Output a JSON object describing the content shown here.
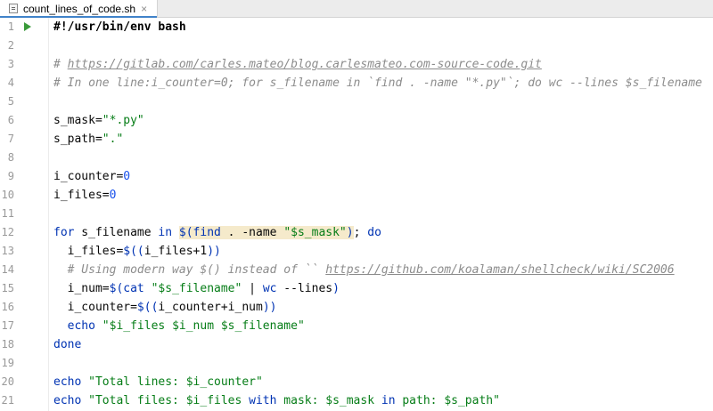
{
  "tab": {
    "label": "count_lines_of_code.sh",
    "close": "×"
  },
  "lines": [
    {
      "n": "1",
      "run": true,
      "parts": [
        {
          "t": "#!/usr/bin/env bash",
          "c": "shebang"
        }
      ]
    },
    {
      "n": "2",
      "parts": []
    },
    {
      "n": "3",
      "parts": [
        {
          "t": "# ",
          "c": "comment"
        },
        {
          "t": "https://gitlab.com/carles.mateo/blog.carlesmateo.com-source-code.git",
          "c": "link"
        }
      ]
    },
    {
      "n": "4",
      "parts": [
        {
          "t": "# In one line:i_counter=0; for s_filename in `find . -name \"*.py\"`; do wc --lines $s_filename",
          "c": "comment"
        }
      ]
    },
    {
      "n": "5",
      "parts": []
    },
    {
      "n": "6",
      "parts": [
        {
          "t": "s_mask=",
          "c": ""
        },
        {
          "t": "\"*.py\"",
          "c": "str"
        }
      ]
    },
    {
      "n": "7",
      "parts": [
        {
          "t": "s_path=",
          "c": ""
        },
        {
          "t": "\".\"",
          "c": "str"
        }
      ]
    },
    {
      "n": "8",
      "parts": []
    },
    {
      "n": "9",
      "parts": [
        {
          "t": "i_counter=",
          "c": ""
        },
        {
          "t": "0",
          "c": "num"
        }
      ]
    },
    {
      "n": "10",
      "parts": [
        {
          "t": "i_files=",
          "c": ""
        },
        {
          "t": "0",
          "c": "num"
        }
      ]
    },
    {
      "n": "11",
      "parts": []
    },
    {
      "n": "12",
      "parts": [
        {
          "t": "for",
          "c": "kw"
        },
        {
          "t": " s_filename ",
          "c": ""
        },
        {
          "t": "in",
          "c": "kw"
        },
        {
          "t": " ",
          "c": ""
        },
        {
          "t": "$(",
          "c": "kw hl"
        },
        {
          "t": "find",
          "c": "cmd hl"
        },
        {
          "t": " . -name ",
          "c": "hl"
        },
        {
          "t": "\"$s_mask\"",
          "c": "str hl"
        },
        {
          "t": ")",
          "c": "kw hl"
        },
        {
          "t": "; ",
          "c": ""
        },
        {
          "t": "do",
          "c": "kw"
        }
      ]
    },
    {
      "n": "13",
      "parts": [
        {
          "t": "  i_files=",
          "c": ""
        },
        {
          "t": "$((",
          "c": "kw"
        },
        {
          "t": "i_files+1",
          "c": ""
        },
        {
          "t": "))",
          "c": "kw"
        }
      ]
    },
    {
      "n": "14",
      "parts": [
        {
          "t": "  # Using modern way $() instead of `` ",
          "c": "comment"
        },
        {
          "t": "https://github.com/koalaman/shellcheck/wiki/SC2006",
          "c": "link"
        }
      ]
    },
    {
      "n": "15",
      "parts": [
        {
          "t": "  i_num=",
          "c": ""
        },
        {
          "t": "$(",
          "c": "kw"
        },
        {
          "t": "cat",
          "c": "cmd"
        },
        {
          "t": " ",
          "c": ""
        },
        {
          "t": "\"$s_filename\"",
          "c": "str"
        },
        {
          "t": " | ",
          "c": ""
        },
        {
          "t": "wc",
          "c": "cmd"
        },
        {
          "t": " --lines",
          "c": ""
        },
        {
          "t": ")",
          "c": "kw"
        }
      ]
    },
    {
      "n": "16",
      "parts": [
        {
          "t": "  i_counter=",
          "c": ""
        },
        {
          "t": "$((",
          "c": "kw"
        },
        {
          "t": "i_counter+i_num",
          "c": ""
        },
        {
          "t": "))",
          "c": "kw"
        }
      ]
    },
    {
      "n": "17",
      "parts": [
        {
          "t": "  ",
          "c": ""
        },
        {
          "t": "echo",
          "c": "cmd"
        },
        {
          "t": " ",
          "c": ""
        },
        {
          "t": "\"$i_files $i_num $s_filename\"",
          "c": "str"
        }
      ]
    },
    {
      "n": "18",
      "parts": [
        {
          "t": "done",
          "c": "kw"
        }
      ]
    },
    {
      "n": "19",
      "parts": []
    },
    {
      "n": "20",
      "parts": [
        {
          "t": "echo",
          "c": "cmd"
        },
        {
          "t": " ",
          "c": ""
        },
        {
          "t": "\"Total lines: $i_counter\"",
          "c": "str"
        }
      ]
    },
    {
      "n": "21",
      "parts": [
        {
          "t": "echo",
          "c": "cmd"
        },
        {
          "t": " ",
          "c": ""
        },
        {
          "t": "\"Total files: $i_files ",
          "c": "str"
        },
        {
          "t": "with",
          "c": "kw"
        },
        {
          "t": " mask: $s_mask ",
          "c": "str"
        },
        {
          "t": "in",
          "c": "kw"
        },
        {
          "t": " path: $s_path\"",
          "c": "str"
        }
      ]
    }
  ]
}
